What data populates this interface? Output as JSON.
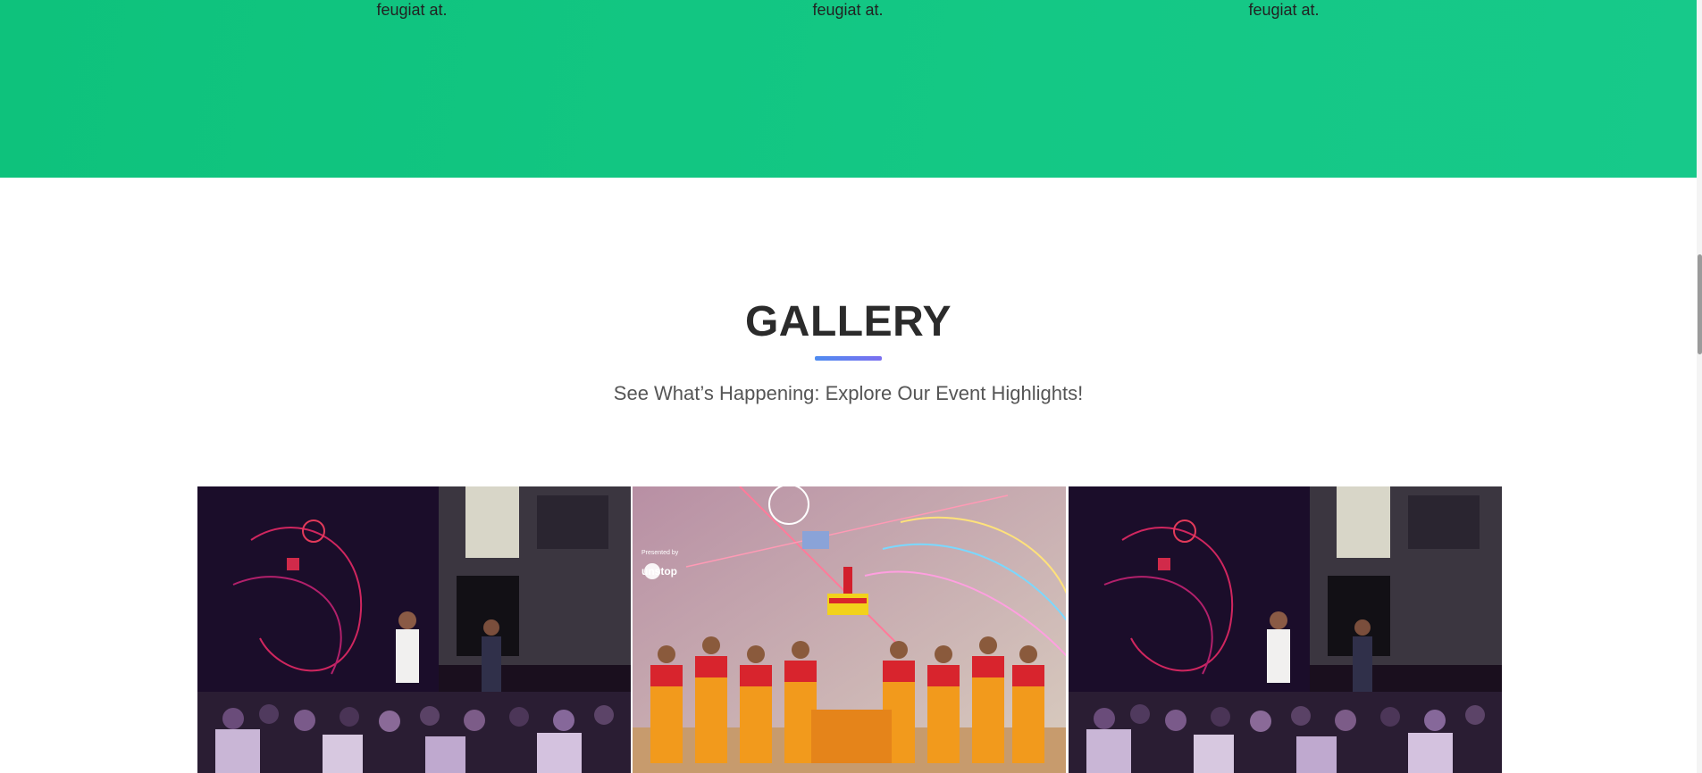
{
  "features": {
    "col1_text": "feugiat at.",
    "col2_text": "feugiat at.",
    "col3_text": "feugiat at."
  },
  "gallery": {
    "title": "GALLERY",
    "subtitle": "See What’s Happening: Explore Our Event Highlights!",
    "images": [
      {
        "alt": "speakers-on-stage-photo"
      },
      {
        "alt": "folk-dance-performance-photo",
        "watermark_line1": "Presented by",
        "watermark_brand": "unstop"
      },
      {
        "alt": "speakers-on-stage-photo"
      }
    ]
  },
  "colors": {
    "band_green": "#12c582",
    "underline_blue": "#5b86ee",
    "title_dark": "#2b2b2b"
  }
}
